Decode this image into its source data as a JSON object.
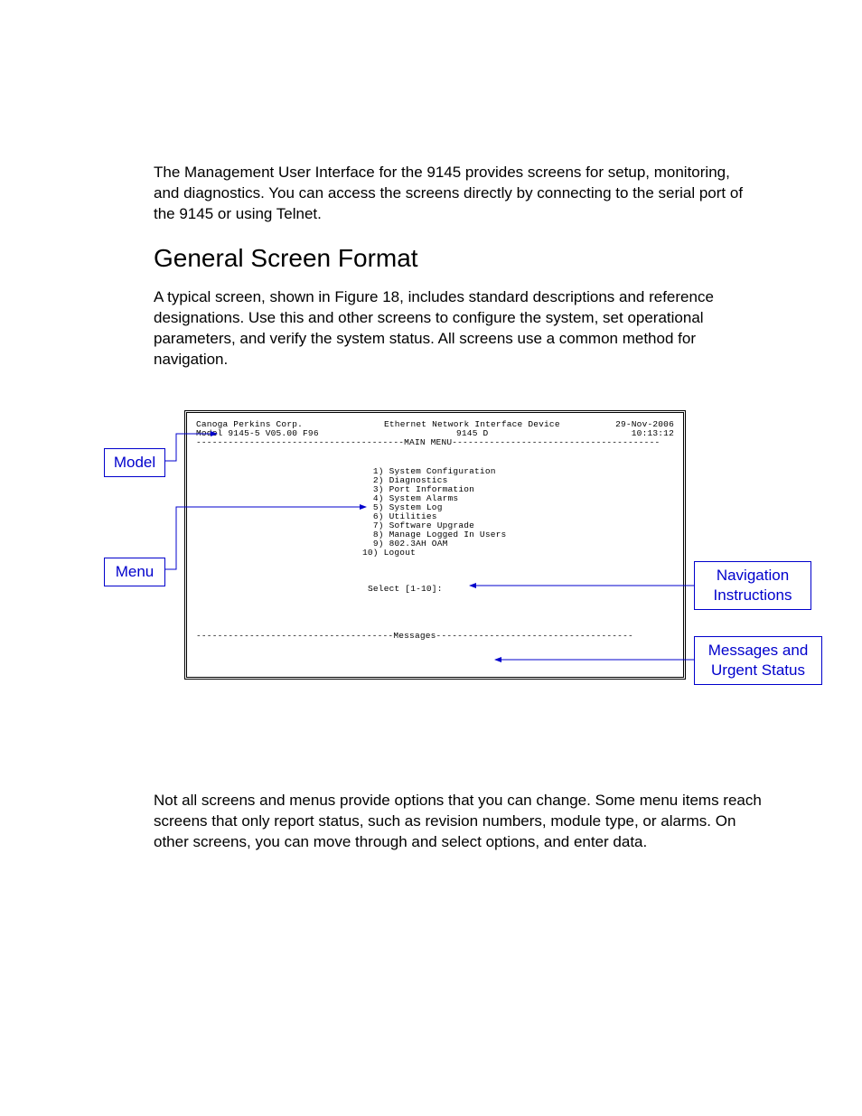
{
  "intro": "The Management User Interface for the 9145 provides screens for setup, monitoring, and diagnostics.  You can access the screens directly by connecting to the serial port of the 9145 or using Telnet.",
  "heading": "General Screen Format",
  "sectionPara": "A typical screen, shown in Figure 18, includes standard descriptions and reference designations.  Use this and other screens to configure the system, set operational parameters, and verify the system status.  All screens use a common method for navigation.",
  "terminal": {
    "header": {
      "company": "Canoga Perkins Corp.",
      "deviceLabel": "Ethernet Network Interface Device",
      "date": "29-Nov-2006",
      "model": "Model 9145-5 V05.00 F96",
      "device": "9145 D",
      "time": "10:13:12"
    },
    "menuDivider": "---------------------------------------MAIN MENU---------------------------------------",
    "menu": [
      " 1) System Configuration",
      " 2) Diagnostics",
      " 3) Port Information",
      " 4) System Alarms",
      " 5) System Log",
      " 6) Utilities",
      " 7) Software Upgrade",
      " 8) Manage Logged In Users",
      " 9) 802.3AH OAM",
      "10) Logout"
    ],
    "prompt": "Select [1-10]:",
    "messagesDivider": "-------------------------------------Messages-------------------------------------"
  },
  "callouts": {
    "model": "Model",
    "menu": "Menu",
    "nav1": "Navigation",
    "nav2": "Instructions",
    "msg1": "Messages and",
    "msg2": "Urgent Status"
  },
  "closing": "Not all screens and menus provide options that you can change.  Some menu items reach screens that only report status, such as revision numbers, module type, or alarms.  On other screens, you can move through and select options, and enter data."
}
